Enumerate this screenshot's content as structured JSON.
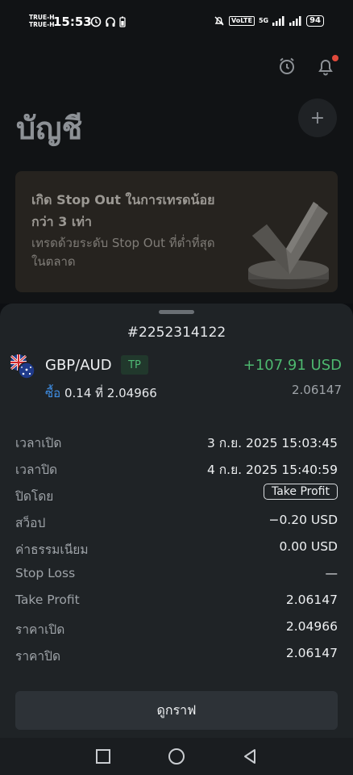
{
  "status_bar": {
    "carrier_line1": "TRUE-H",
    "carrier_line2": "TRUE-H",
    "time": "15:53",
    "volte": "VoLTE",
    "network": "5G",
    "battery": "94"
  },
  "page": {
    "title": "บัญชี",
    "add_label": "+"
  },
  "promo": {
    "title": "เกิด Stop Out ในการเทรดน้อยกว่า 3 เท่า",
    "subtitle": "เทรดด้วยระดับ Stop Out ที่ต่ำที่สุดในตลาด"
  },
  "sheet": {
    "order_id": "#2252314122",
    "symbol": "GBP/AUD",
    "tag": "TP",
    "profit": "+107.91 USD",
    "side": "ซื้อ",
    "volume_price": "0.14 ที่ 2.04966",
    "current_price": "2.06147",
    "details": [
      {
        "label": "เวลาเปิด",
        "value": "3 ก.ย. 2025 15:03:45"
      },
      {
        "label": "เวลาปิด",
        "value": "4 ก.ย. 2025 15:40:59"
      },
      {
        "label": "ปิดโดย",
        "value": "Take Profit"
      },
      {
        "label": "สว็อป",
        "value": "−0.20 USD"
      },
      {
        "label": "ค่าธรรมเนียม",
        "value": "0.00 USD"
      },
      {
        "label": "Stop Loss",
        "value": "—"
      },
      {
        "label": "Take Profit",
        "value": "2.06147"
      },
      {
        "label": "ราคาเปิด",
        "value": "2.04966"
      },
      {
        "label": "ราคาปิด",
        "value": "2.06147"
      }
    ],
    "chart_button": "ดูกราฟ"
  },
  "colors": {
    "profit": "#4db86f",
    "buy": "#3f8fe6",
    "sheet_bg": "#1f2326"
  }
}
